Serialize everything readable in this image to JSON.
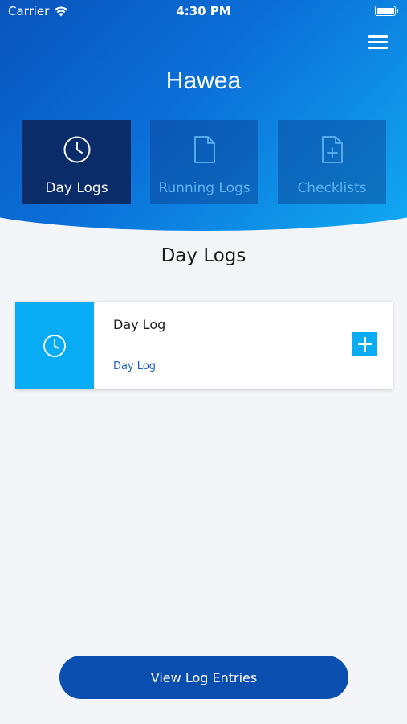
{
  "status_bar": {
    "carrier": "Carrier",
    "time": "4:30 PM"
  },
  "header": {
    "title": "Hawea",
    "menu_icon": "hamburger-menu-icon"
  },
  "tabs": [
    {
      "label": "Day Logs",
      "icon": "clock-icon",
      "active": true
    },
    {
      "label": "Running Logs",
      "icon": "document-icon",
      "active": false
    },
    {
      "label": "Checklists",
      "icon": "document-add-icon",
      "active": false
    }
  ],
  "section": {
    "title": "Day Logs"
  },
  "log_items": [
    {
      "title": "Day Log",
      "subtitle": "Day Log",
      "icon": "clock-icon",
      "action_icon": "plus-icon"
    }
  ],
  "footer": {
    "view_entries_label": "View Log Entries"
  },
  "colors": {
    "header_gradient_start": "#0a4fb8",
    "header_gradient_end": "#12b1f5",
    "active_tab": "#0a2c68",
    "accent": "#07acf4",
    "button": "#0a4fb0",
    "link": "#1560b8",
    "background": "#f3f5f8"
  }
}
